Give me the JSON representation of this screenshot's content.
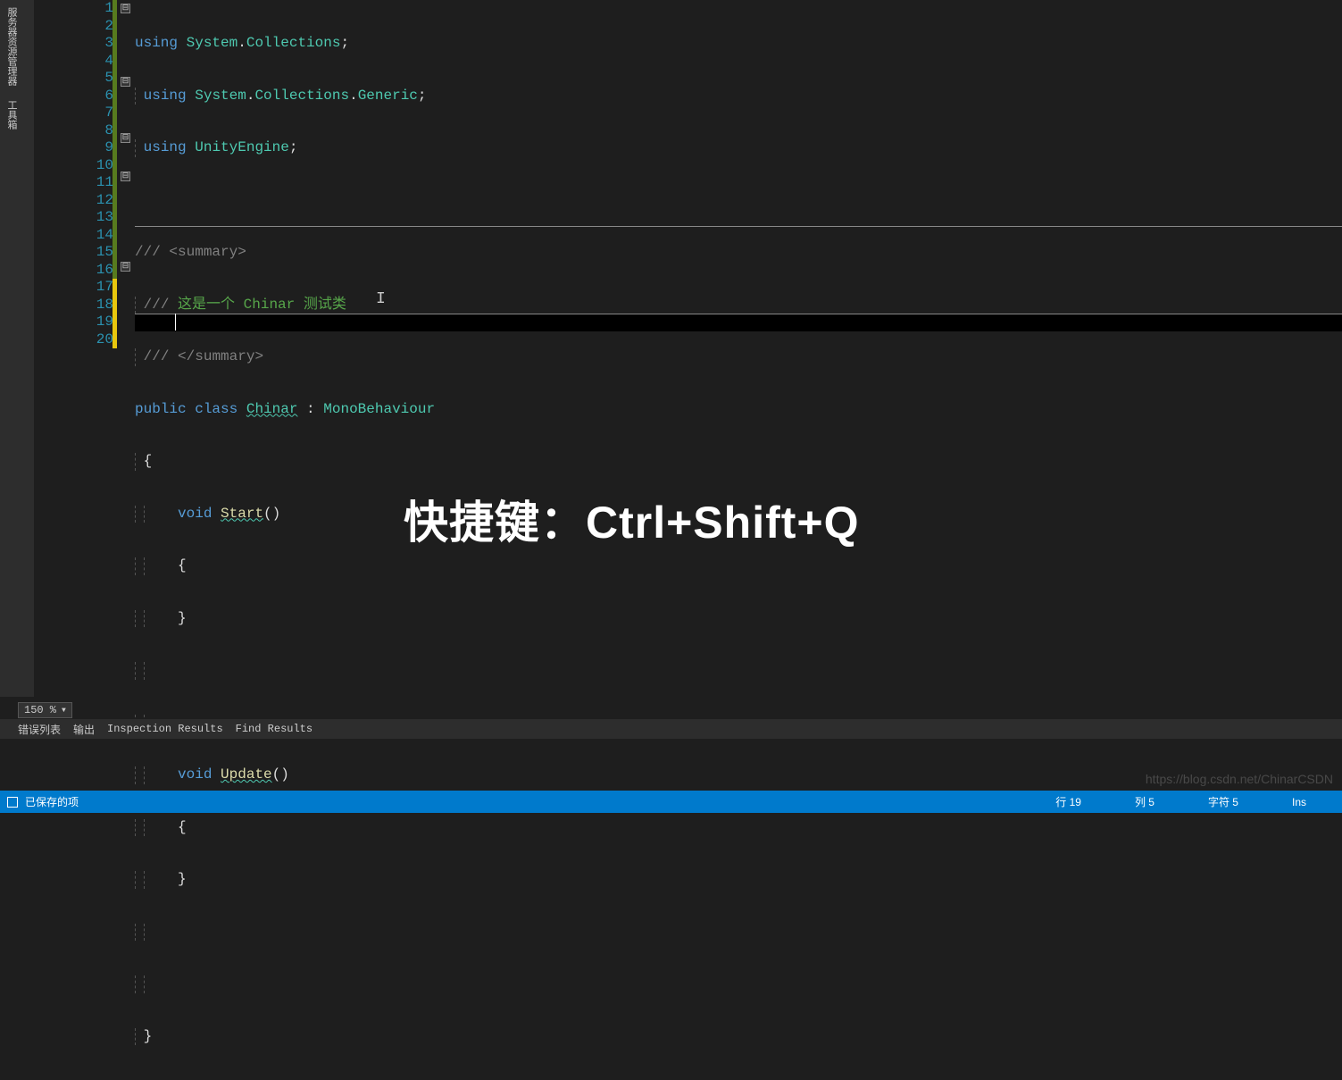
{
  "side_tabs": [
    "服务器资源管理器",
    "工具箱"
  ],
  "lines": {
    "n1": "1",
    "n2": "2",
    "n3": "3",
    "n4": "4",
    "n5": "5",
    "n6": "6",
    "n7": "7",
    "n8": "8",
    "n9": "9",
    "n10": "10",
    "n11": "11",
    "n12": "12",
    "n13": "13",
    "n14": "14",
    "n15": "15",
    "n16": "16",
    "n17": "17",
    "n18": "18",
    "n19": "19",
    "n20": "20"
  },
  "code": {
    "using": "using",
    "system": "System",
    "collections": "Collections",
    "generic": "Generic",
    "unityengine": "UnityEngine",
    "semicolon": ";",
    "dot": ".",
    "slashes": "///",
    "summary_open": "<summary>",
    "summary_close": "</summary>",
    "comment_cn": "这是一个 ",
    "comment_chinar": "Chinar",
    "comment_test": " 测试类",
    "public": "public",
    "class": "class",
    "chinar": "Chinar",
    "colon": " : ",
    "mono": "MonoBehaviour",
    "lbrace": "{",
    "rbrace": "}",
    "void": "void",
    "start": "Start",
    "update": "Update",
    "parens": "()"
  },
  "overlay": "快捷键：Ctrl+Shift+Q",
  "zoom": "150 %",
  "bottom_tabs": [
    "错误列表",
    "输出",
    "Inspection Results",
    "Find Results"
  ],
  "status": {
    "saved": "已保存的项",
    "line": "行 19",
    "col": "列 5",
    "char": "字符 5",
    "ins": "Ins"
  },
  "watermark": "https://blog.csdn.net/ChinarCSDN",
  "fold_minus": "⊟"
}
